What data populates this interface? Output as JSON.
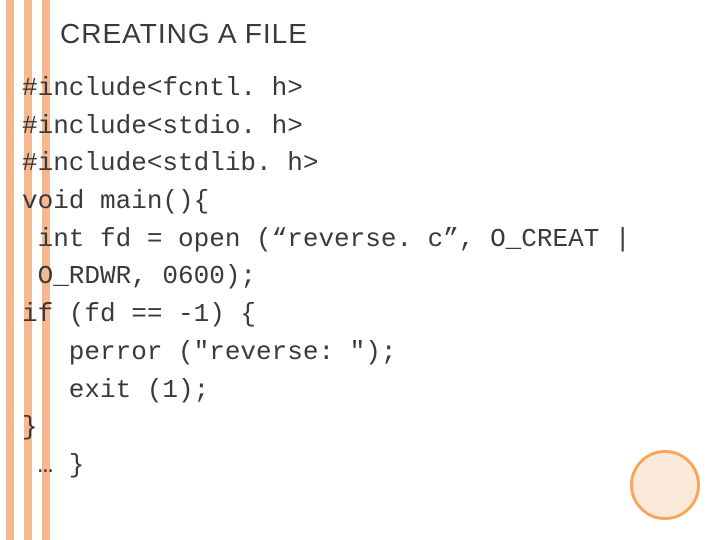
{
  "title": "CREATING A FILE",
  "code_lines": [
    "#include<fcntl. h>",
    "#include<stdio. h>",
    "#include<stdlib. h>",
    "void main(){",
    " int fd = open (“reverse. c”, O_CREAT |",
    " O_RDWR, 0600);",
    "if (fd == -1) {",
    "   perror (\"reverse: \");",
    "   exit (1);",
    "}",
    " … }"
  ]
}
